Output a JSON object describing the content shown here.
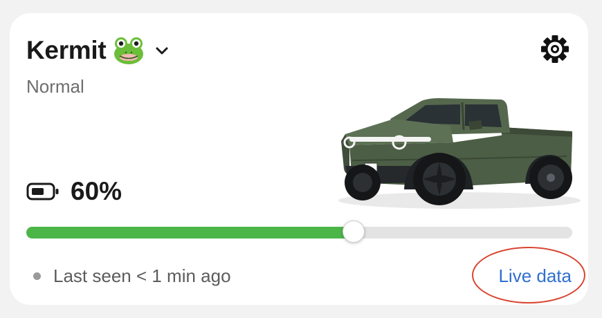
{
  "vehicle": {
    "name": "Kermit",
    "emoji_icon": "frog-face-icon",
    "mode": "Normal"
  },
  "battery": {
    "percent_label": "60%",
    "charge_fraction": 0.6
  },
  "status": {
    "last_seen": "Last seen < 1 min ago",
    "dot_color": "#9a9a9a"
  },
  "actions": {
    "live_data_label": "Live data"
  },
  "colors": {
    "battery_fill": "#4cb548",
    "link": "#2f6fcf",
    "truck_body": "#4c5e45",
    "highlight": "#d9432f"
  },
  "icons": {
    "settings": "gear-icon",
    "dropdown": "chevron-down-icon",
    "battery": "battery-icon",
    "vehicle_image": "pickup-truck-image"
  }
}
